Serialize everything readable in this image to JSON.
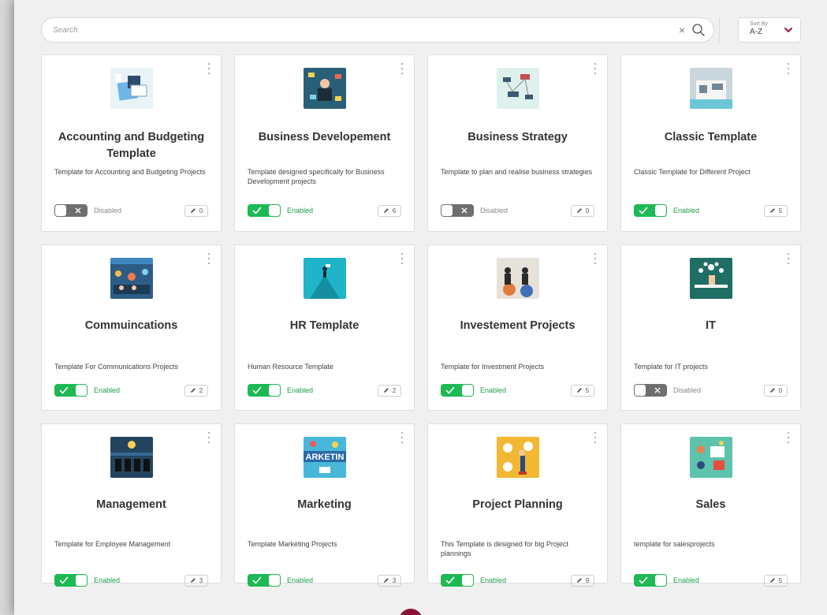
{
  "search": {
    "placeholder": "Search",
    "clear_icon": "close-icon",
    "search_icon": "search-icon"
  },
  "sort": {
    "label": "Sort By",
    "value": "A-Z",
    "icon": "chevron-down-icon",
    "accent": "#a3123f"
  },
  "colors": {
    "enabled": "#1db954",
    "disabled": "#6f6f6f",
    "accent": "#8b1436"
  },
  "cards": [
    {
      "title": "Accounting and Budgeting Template",
      "description": "Template for Accounting and Budgeting Projects",
      "status": "Disabled",
      "enabled": false,
      "count": "0",
      "thumb": "accounting",
      "thumb_bg": "#e8f3f8"
    },
    {
      "title": "Business Developement",
      "description": "Template designed specifically for Business Development projects",
      "status": "Enabled",
      "enabled": true,
      "count": "6",
      "thumb": "business-dev",
      "thumb_bg": "#2a5f78"
    },
    {
      "title": "Business Strategy",
      "description": "Template to plan and realise business strategies",
      "status": "Disabled",
      "enabled": false,
      "count": "0",
      "thumb": "strategy",
      "thumb_bg": "#dff1ef"
    },
    {
      "title": "Classic Template",
      "description": "Classic Template for Different Project",
      "status": "Enabled",
      "enabled": true,
      "count": "5",
      "thumb": "classic",
      "thumb_bg": "#c9d6de"
    },
    {
      "title": "Commuincations",
      "description": "Template For Communications Projects",
      "status": "Enabled",
      "enabled": true,
      "count": "2",
      "thumb": "communications",
      "thumb_bg": "#2d5d86"
    },
    {
      "title": "HR Template",
      "description": "Human Resource Template",
      "status": "Enabled",
      "enabled": true,
      "count": "2",
      "thumb": "hr",
      "thumb_bg": "#1fb4c7"
    },
    {
      "title": "Investement Projects",
      "description": "Template for Investment Projects",
      "status": "Enabled",
      "enabled": true,
      "count": "5",
      "thumb": "investment",
      "thumb_bg": "#e7e2d8"
    },
    {
      "title": "IT",
      "description": "Template for IT projects",
      "status": "Disabled",
      "enabled": false,
      "count": "0",
      "thumb": "it",
      "thumb_bg": "#1f6e64"
    },
    {
      "title": "Management",
      "description": "Template for Employee Management",
      "status": "Enabled",
      "enabled": true,
      "count": "3",
      "thumb": "management",
      "thumb_bg": "#23445f"
    },
    {
      "title": "Marketing",
      "description": "Template Marketing Projects",
      "status": "Enabled",
      "enabled": true,
      "count": "3",
      "thumb": "marketing",
      "thumb_bg": "#48b7d9"
    },
    {
      "title": "Project Planning",
      "description": "This Template is designed for big Project plannings",
      "status": "Enabled",
      "enabled": true,
      "count": "9",
      "thumb": "planning",
      "thumb_bg": "#f2b733"
    },
    {
      "title": "Sales",
      "description": "template for salesprojects",
      "status": "Enabled",
      "enabled": true,
      "count": "5",
      "thumb": "sales",
      "thumb_bg": "#5ec3ad"
    }
  ]
}
